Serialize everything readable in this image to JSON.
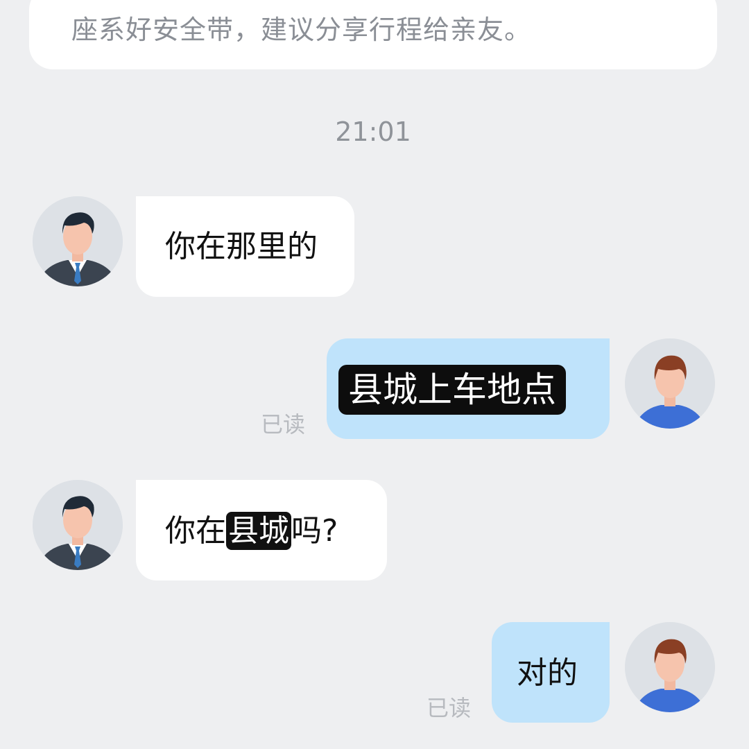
{
  "notice": {
    "text": "座系好安全带，建议分享行程给亲友。"
  },
  "timestamp": "21:01",
  "messages": [
    {
      "side": "left",
      "text": "你在那里的"
    },
    {
      "side": "right",
      "text": "县城上车地点",
      "status": "已读"
    },
    {
      "side": "left",
      "text_before": "你在",
      "text_highlight": "县城",
      "text_after": "吗?"
    },
    {
      "side": "right",
      "text": "对的",
      "status": "已读"
    }
  ],
  "icons": {
    "driver_avatar": "driver-avatar-icon",
    "passenger_avatar": "passenger-avatar-icon"
  },
  "colors": {
    "background": "#eeeff1",
    "incoming_bubble": "#ffffff",
    "outgoing_bubble": "#bfe3fb",
    "highlight": "#111111",
    "read_status": "#b7babf"
  }
}
